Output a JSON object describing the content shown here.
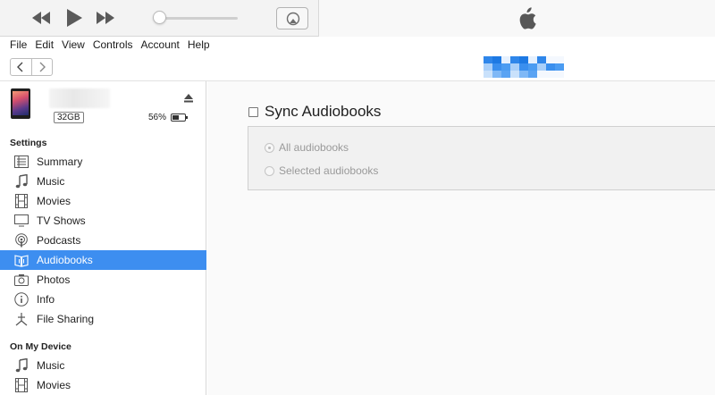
{
  "player": {
    "transport_icons": [
      "rewind-icon",
      "play-icon",
      "fast-forward-icon"
    ],
    "volume_level_percent": 0,
    "airplay_icon": "airplay-icon",
    "display_icon": "apple-logo-icon"
  },
  "menu": {
    "items": [
      "File",
      "Edit",
      "View",
      "Controls",
      "Account",
      "Help"
    ]
  },
  "navigation": {
    "back_icon": "chevron-left-icon",
    "forward_icon": "chevron-right-icon"
  },
  "device": {
    "capacity": "32GB",
    "battery_percent": "56%",
    "battery_level": 0.56,
    "eject_icon": "eject-icon"
  },
  "sidebar": {
    "settings_heading": "Settings",
    "settings_items": [
      {
        "label": "Summary",
        "icon": "summary-icon"
      },
      {
        "label": "Music",
        "icon": "music-note-icon"
      },
      {
        "label": "Movies",
        "icon": "film-icon"
      },
      {
        "label": "TV Shows",
        "icon": "tv-icon"
      },
      {
        "label": "Podcasts",
        "icon": "podcast-icon"
      },
      {
        "label": "Audiobooks",
        "icon": "audiobook-icon",
        "selected": true
      },
      {
        "label": "Photos",
        "icon": "camera-icon"
      },
      {
        "label": "Info",
        "icon": "info-icon"
      },
      {
        "label": "File Sharing",
        "icon": "file-sharing-icon"
      }
    ],
    "device_heading": "On My Device",
    "device_items": [
      {
        "label": "Music",
        "icon": "music-note-icon"
      },
      {
        "label": "Movies",
        "icon": "film-icon"
      }
    ]
  },
  "main": {
    "sync_label": "Sync Audiobooks",
    "sync_checked": false,
    "options": [
      {
        "label": "All audiobooks",
        "selected": true
      },
      {
        "label": "Selected audiobooks",
        "selected": false
      }
    ]
  },
  "colors": {
    "selection": "#3d8ef0",
    "sidebar_bg": "#ffffff",
    "panel_bg": "#fafafa"
  }
}
